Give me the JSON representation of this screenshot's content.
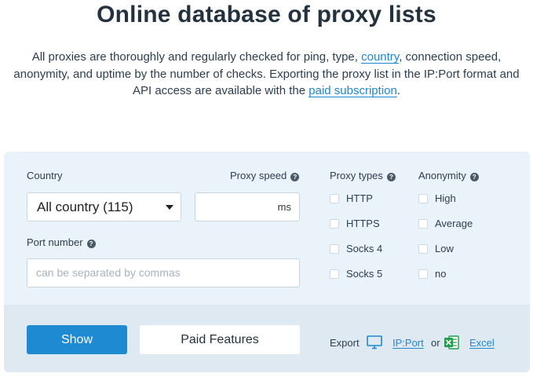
{
  "header": {
    "title": "Online database of proxy lists",
    "intro_part1": "All proxies are thoroughly and regularly checked for ping, type, ",
    "country_link": "country",
    "intro_part2": ", connection speed, anonymity, and uptime by the number of checks. Exporting the proxy list in the IP:Port format and API access are available with the ",
    "paid_link": "paid subscription",
    "intro_part3": "."
  },
  "filters": {
    "country_label": "Country",
    "country_value": "All country (115)",
    "speed_label": "Proxy speed",
    "speed_unit": "ms",
    "speed_value": "",
    "port_label": "Port number",
    "port_placeholder": "can be separated by commas",
    "help_glyph": "?",
    "types_label": "Proxy types",
    "types": [
      {
        "label": "HTTP",
        "checked": false
      },
      {
        "label": "HTTPS",
        "checked": false
      },
      {
        "label": "Socks 4",
        "checked": false
      },
      {
        "label": "Socks 5",
        "checked": false
      }
    ],
    "anonymity_label": "Anonymity",
    "anonymity": [
      {
        "label": "High",
        "checked": false
      },
      {
        "label": "Average",
        "checked": false
      },
      {
        "label": "Low",
        "checked": false
      },
      {
        "label": "no",
        "checked": false
      }
    ]
  },
  "actions": {
    "show_label": "Show",
    "paid_label": "Paid Features",
    "export_label": "Export",
    "ipport_label": "IP:Port",
    "or_label": "or",
    "excel_label": "Excel",
    "ipport_icon": "monitor-icon",
    "excel_icon": "excel-icon"
  },
  "colors": {
    "accent": "#1e8ad2",
    "link": "#1e88d0",
    "panel": "#eaf3fa",
    "panel_bottom": "#dfe9f1",
    "excel_green": "#1e9e4a"
  }
}
